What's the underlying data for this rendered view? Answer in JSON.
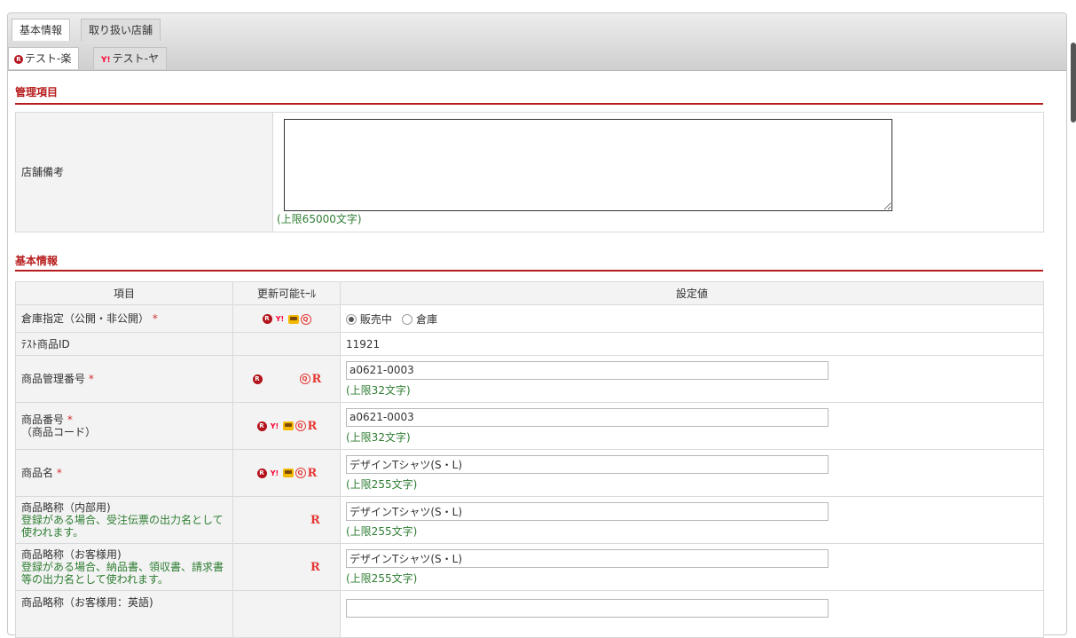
{
  "tabs_row1": [
    {
      "label": "基本情報",
      "active": true
    },
    {
      "label": "取り扱い店舗",
      "active": false
    }
  ],
  "tabs_row2": [
    {
      "label": "テスト-楽",
      "icon": "rakuten-icon",
      "active": true
    },
    {
      "label": "テスト-ヤ",
      "icon": "yahoo-icon",
      "active": false
    }
  ],
  "management": {
    "title": "管理項目",
    "store_note_label": "店舗備考",
    "store_note_value": "",
    "store_note_limit": "(上限65000文字)"
  },
  "basic": {
    "title": "基本情報",
    "headers": {
      "item": "項目",
      "malls": "更新可能ﾓｰﾙ",
      "value": "設定値"
    },
    "warehouse": {
      "label": "倉庫指定（公開・非公開）",
      "required": "*",
      "options": [
        "販売中",
        "倉庫"
      ],
      "selected": "販売中"
    },
    "product_id": {
      "label": "ﾃｽﾄ商品ID",
      "value": "11921"
    },
    "mgmt_no": {
      "label": "商品管理番号",
      "required": "*",
      "value": "a0621-0003",
      "limit": "(上限32文字)"
    },
    "product_no": {
      "label": "商品番号",
      "required": "*",
      "sub": "（商品コード）",
      "value": "a0621-0003",
      "limit": "(上限32文字)"
    },
    "product_name": {
      "label": "商品名",
      "required": "*",
      "value": "デザインTシャツ(S・L)",
      "limit": "(上限255文字)"
    },
    "internal_abbr": {
      "label": "商品略称（内部用)",
      "note": "登録がある場合、受注伝票の出力名として使われます。",
      "value": "デザインTシャツ(S・L)",
      "limit": "(上限255文字)"
    },
    "customer_abbr": {
      "label": "商品略称（お客様用)",
      "note": "登録がある場合、納品書、領収書、請求書等の出力名として使われます。",
      "value": "デザインTシャツ(S・L)",
      "limit": "(上限255文字)"
    },
    "english_abbr": {
      "label": "商品略称（お客様用：英語)",
      "value": ""
    }
  },
  "colors": {
    "accent": "#b71c1c",
    "note": "#2e7d32",
    "required": "#d32f2f"
  }
}
